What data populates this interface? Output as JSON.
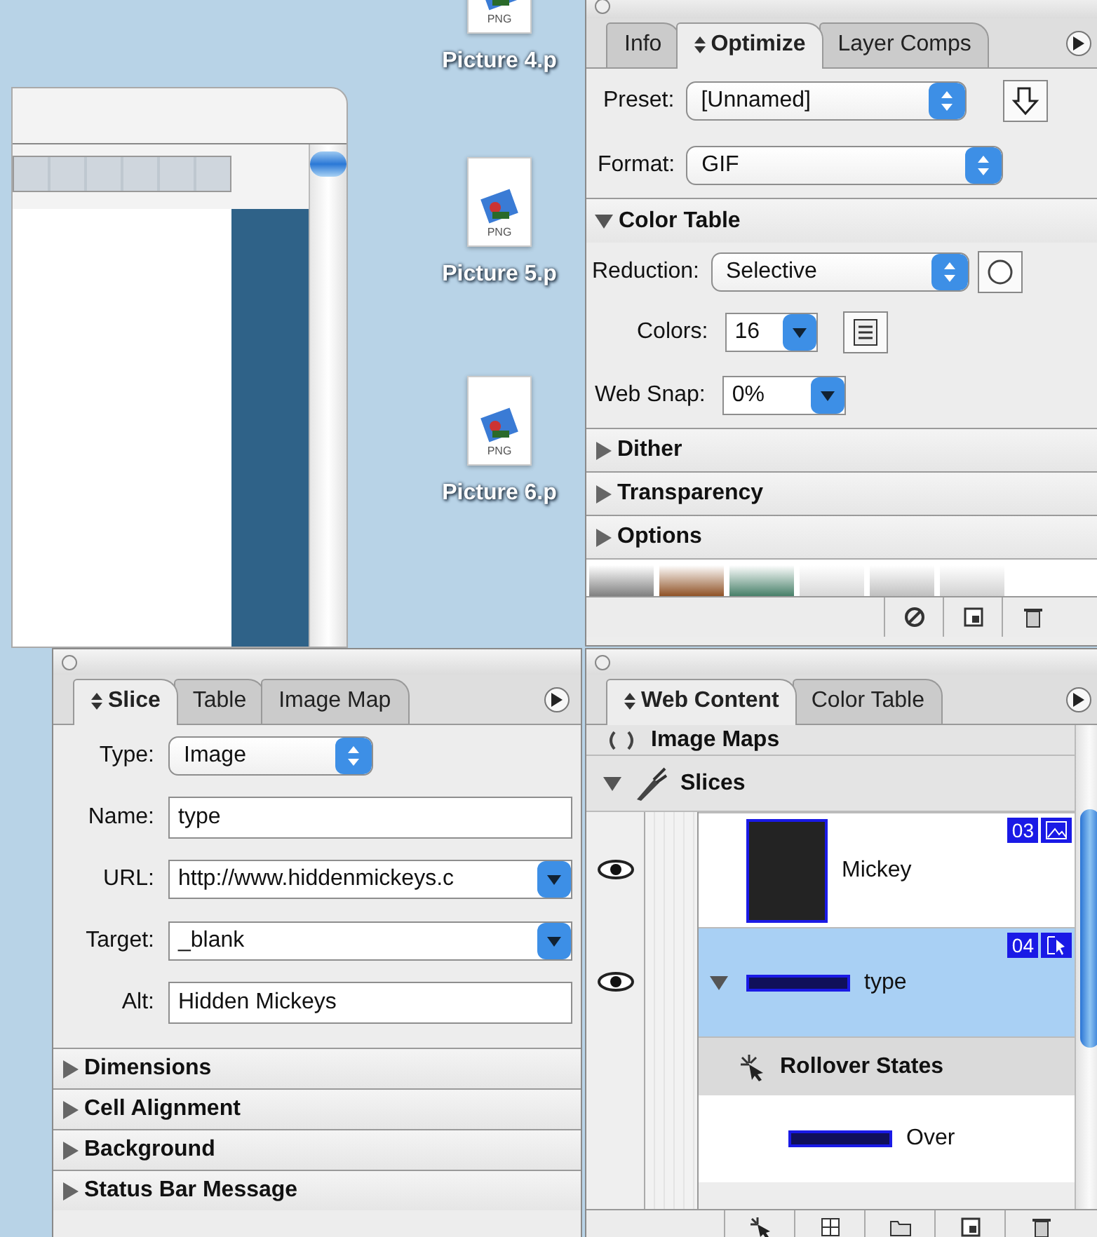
{
  "desktop_icons": [
    {
      "file_type": "PNG",
      "label": "Picture 4.p"
    },
    {
      "file_type": "PNG",
      "label": "Picture 5.p"
    },
    {
      "file_type": "PNG",
      "label": "Picture 6.p"
    }
  ],
  "optimize_panel": {
    "tabs": [
      {
        "label": "Info",
        "selected": false
      },
      {
        "label": "Optimize",
        "selected": true
      },
      {
        "label": "Layer Comps",
        "selected": false
      }
    ],
    "preset": {
      "label": "Preset:",
      "value": "[Unnamed]"
    },
    "format": {
      "label": "Format:",
      "value": "GIF"
    },
    "color_table": {
      "label": "Color Table",
      "expanded": true,
      "reduction": {
        "label": "Reduction:",
        "value": "Selective"
      },
      "colors": {
        "label": "Colors:",
        "value": "16"
      },
      "web_snap": {
        "label": "Web Snap:",
        "value": "0%"
      }
    },
    "sections": [
      {
        "label": "Dither",
        "expanded": false
      },
      {
        "label": "Transparency",
        "expanded": false
      },
      {
        "label": "Options",
        "expanded": false
      }
    ]
  },
  "slice_panel": {
    "tabs": [
      {
        "label": "Slice",
        "selected": true
      },
      {
        "label": "Table",
        "selected": false
      },
      {
        "label": "Image Map",
        "selected": false
      }
    ],
    "fields": [
      {
        "kind": "select",
        "label": "Type:",
        "value": "Image"
      },
      {
        "kind": "text",
        "label": "Name:",
        "value": "type"
      },
      {
        "kind": "combo",
        "label": "URL:",
        "value": "http://www.hiddenmickeys.c"
      },
      {
        "kind": "combo",
        "label": "Target:",
        "value": "_blank"
      },
      {
        "kind": "text",
        "label": "Alt:",
        "value": "Hidden Mickeys"
      }
    ],
    "sections": [
      {
        "label": "Dimensions",
        "expanded": false
      },
      {
        "label": "Cell Alignment",
        "expanded": false
      },
      {
        "label": "Background",
        "expanded": false
      },
      {
        "label": "Status Bar Message",
        "expanded": false
      }
    ]
  },
  "web_content_panel": {
    "tabs": [
      {
        "label": "Web Content",
        "selected": true
      },
      {
        "label": "Color Table",
        "selected": false
      }
    ],
    "tree": [
      {
        "kind": "group",
        "label": "Image Maps",
        "selected": false
      },
      {
        "kind": "group",
        "label": "Slices",
        "selected": false,
        "expanded": true,
        "children": [
          {
            "kind": "slice",
            "label": "Mickey",
            "number": "03",
            "visible": true,
            "selected": false
          },
          {
            "kind": "slice",
            "label": "type",
            "number": "04",
            "visible": true,
            "selected": true,
            "expanded": true,
            "children": [
              {
                "kind": "rollover-states",
                "label": "Rollover States",
                "selected": false
              },
              {
                "kind": "state",
                "label": "Over",
                "selected": false
              }
            ]
          }
        ]
      }
    ]
  }
}
